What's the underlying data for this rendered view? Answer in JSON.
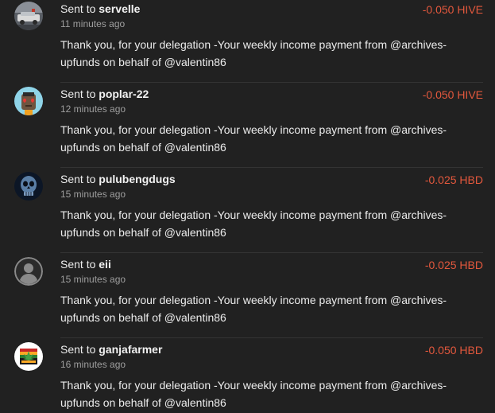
{
  "transfers": [
    {
      "sent_prefix": "Sent to",
      "user": "servelle",
      "amount": "-0.050 HIVE",
      "time": "11 minutes ago",
      "memo": "Thank you, for your delegation -Your weekly income payment from @archives-upfunds on behalf of @valentin86",
      "avatar_icon": "car-photo-avatar-icon"
    },
    {
      "sent_prefix": "Sent to",
      "user": "poplar-22",
      "amount": "-0.050 HIVE",
      "time": "12 minutes ago",
      "memo": "Thank you, for your delegation -Your weekly income payment from @archives-upfunds on behalf of @valentin86",
      "avatar_icon": "heart-eyes-ape-avatar-icon"
    },
    {
      "sent_prefix": "Sent to",
      "user": "pulubengdugs",
      "amount": "-0.025 HBD",
      "time": "15 minutes ago",
      "memo": "Thank you, for your delegation -Your weekly income payment from @archives-upfunds on behalf of @valentin86",
      "avatar_icon": "skull-avatar-icon"
    },
    {
      "sent_prefix": "Sent to",
      "user": "eii",
      "amount": "-0.025 HBD",
      "time": "15 minutes ago",
      "memo": "Thank you, for your delegation -Your weekly income payment from @archives-upfunds on behalf of @valentin86",
      "avatar_icon": "default-user-avatar-icon"
    },
    {
      "sent_prefix": "Sent to",
      "user": "ganjafarmer",
      "amount": "-0.050 HBD",
      "time": "16 minutes ago",
      "memo": "Thank you, for your delegation -Your weekly income payment from @archives-upfunds on behalf of @valentin86",
      "avatar_icon": "leaf-logo-avatar-icon"
    }
  ],
  "colors": {
    "background": "#212121",
    "amount": "#e3583d",
    "timestamp": "#9e9e9e",
    "divider": "#333333"
  }
}
